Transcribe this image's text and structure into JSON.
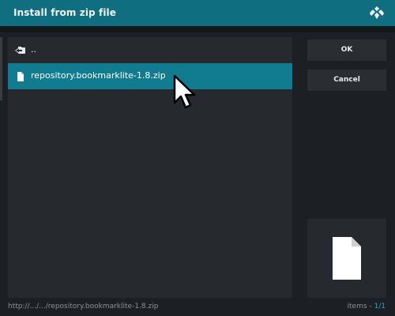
{
  "dialog": {
    "title": "Install from zip file",
    "logo_icon": "kodi-logo-icon"
  },
  "file_list": {
    "items": [
      {
        "label": "..",
        "icon": "back-folder-icon"
      },
      {
        "label": "repository.bookmarklite-1.8.zip",
        "icon": "file-icon",
        "selected": true
      }
    ]
  },
  "buttons": {
    "ok_label": "OK",
    "cancel_label": "Cancel"
  },
  "preview": {
    "icon": "file-icon"
  },
  "footer": {
    "path": "http://.../.../repository.bookmarklite-1.8.zip",
    "items_label": "items - ",
    "items_count": "1/1"
  },
  "colors": {
    "title_bar": "#0f6e80",
    "selected_row": "#117b90",
    "accent_text": "#2aa6c4",
    "background": "#1c1f23",
    "panel": "#26292d"
  }
}
